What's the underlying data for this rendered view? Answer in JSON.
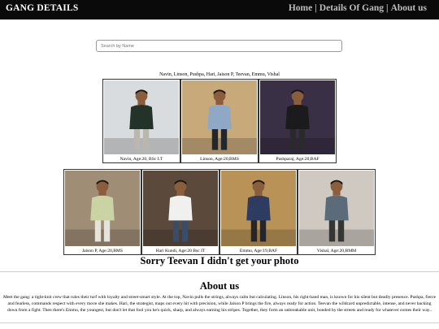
{
  "navbar": {
    "brand": "GANG DETAILS",
    "links": [
      {
        "label": "Home"
      },
      {
        "label": "Details Of Gang"
      },
      {
        "label": "About us"
      }
    ],
    "separator": "|"
  },
  "search": {
    "placeholder": "Search by Name",
    "value": ""
  },
  "names_line": "Navin, Linson, Pushpa, Hari, Jaison P, Teevan, Emmu, Vishal",
  "members": [
    {
      "caption": "Navin, Age:20, BSc I.T",
      "bg": "#d9dcdf",
      "shirt": "#23332a",
      "pants": "#bcb7ae"
    },
    {
      "caption": "Linson, Age:20,BMS",
      "bg": "#c7a97a",
      "shirt": "#8fa8c6",
      "pants": "#23262b"
    },
    {
      "caption": "Pushparaj, Age:20,BAF",
      "bg": "#3a3046",
      "shirt": "#1b1b1d",
      "pants": "#2a2a2c"
    },
    {
      "caption": "Jaison P, Age:20,BMS",
      "bg": "#a08d76",
      "shirt": "#c9d3a3",
      "pants": "#e6e3da"
    },
    {
      "caption": "Hari Kundi, Age:20 Bsc IT",
      "bg": "#5b4a3b",
      "shirt": "#f0f0ef",
      "pants": "#3b4c68"
    },
    {
      "caption": "Emmu, Age:19,BAF",
      "bg": "#b89256",
      "shirt": "#2f3c62",
      "pants": "#26262a"
    },
    {
      "caption": "Vishal, Age:20,BMM",
      "bg": "#cfc9c1",
      "shirt": "#5b6b7a",
      "pants": "#353535"
    }
  ],
  "sorry_text": "Sorry Teevan I didn't get your photo",
  "about": {
    "title": "About us",
    "text": "Meet the gang: a tight-knit crew that rules their turf with loyalty and street-smart style. At the top, Navin pulls the strings, always calm but calculating. Linson, his right-hand man, is known for his silent but deadly presence. Pushpa, fierce and fearless, commands respect with every move she makes. Hari, the strategist, maps out every hit with precision, while Jaison P brings the fire, always ready for action. Teevan the wildcard unpredictable, intense, and never backing down from a fight. Then there's Emmu, the youngest, but don't let that fool you he's quick, sharp, and always earning his stripes. Together, they form an unbreakable unit, bonded by the streets and ready for whatever comes their way.."
  }
}
